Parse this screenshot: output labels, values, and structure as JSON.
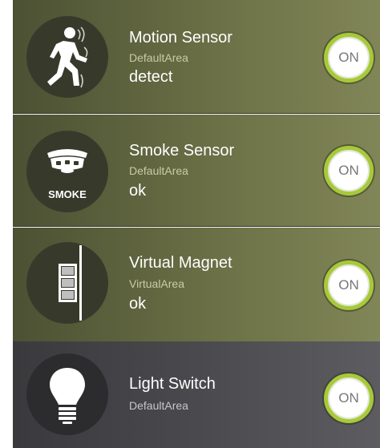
{
  "devices": [
    {
      "title": "Motion Sensor",
      "area": "DefaultArea",
      "status": "detect",
      "toggle_label": "ON",
      "icon": "motion-icon"
    },
    {
      "title": "Smoke Sensor",
      "area": "DefaultArea",
      "status": "ok",
      "toggle_label": "ON",
      "icon": "smoke-detector-icon",
      "icon_text": "SMOKE"
    },
    {
      "title": "Virtual Magnet",
      "area": "VirtualArea",
      "status": "ok",
      "toggle_label": "ON",
      "icon": "door-magnet-icon"
    },
    {
      "title": "Light Switch",
      "area": "DefaultArea",
      "toggle_label": "ON",
      "icon": "light-bulb-icon"
    }
  ],
  "colors": {
    "toggle_ring": "#a7c93a",
    "row_olive": "#6b7046",
    "row_dark": "#4a4a4e"
  }
}
